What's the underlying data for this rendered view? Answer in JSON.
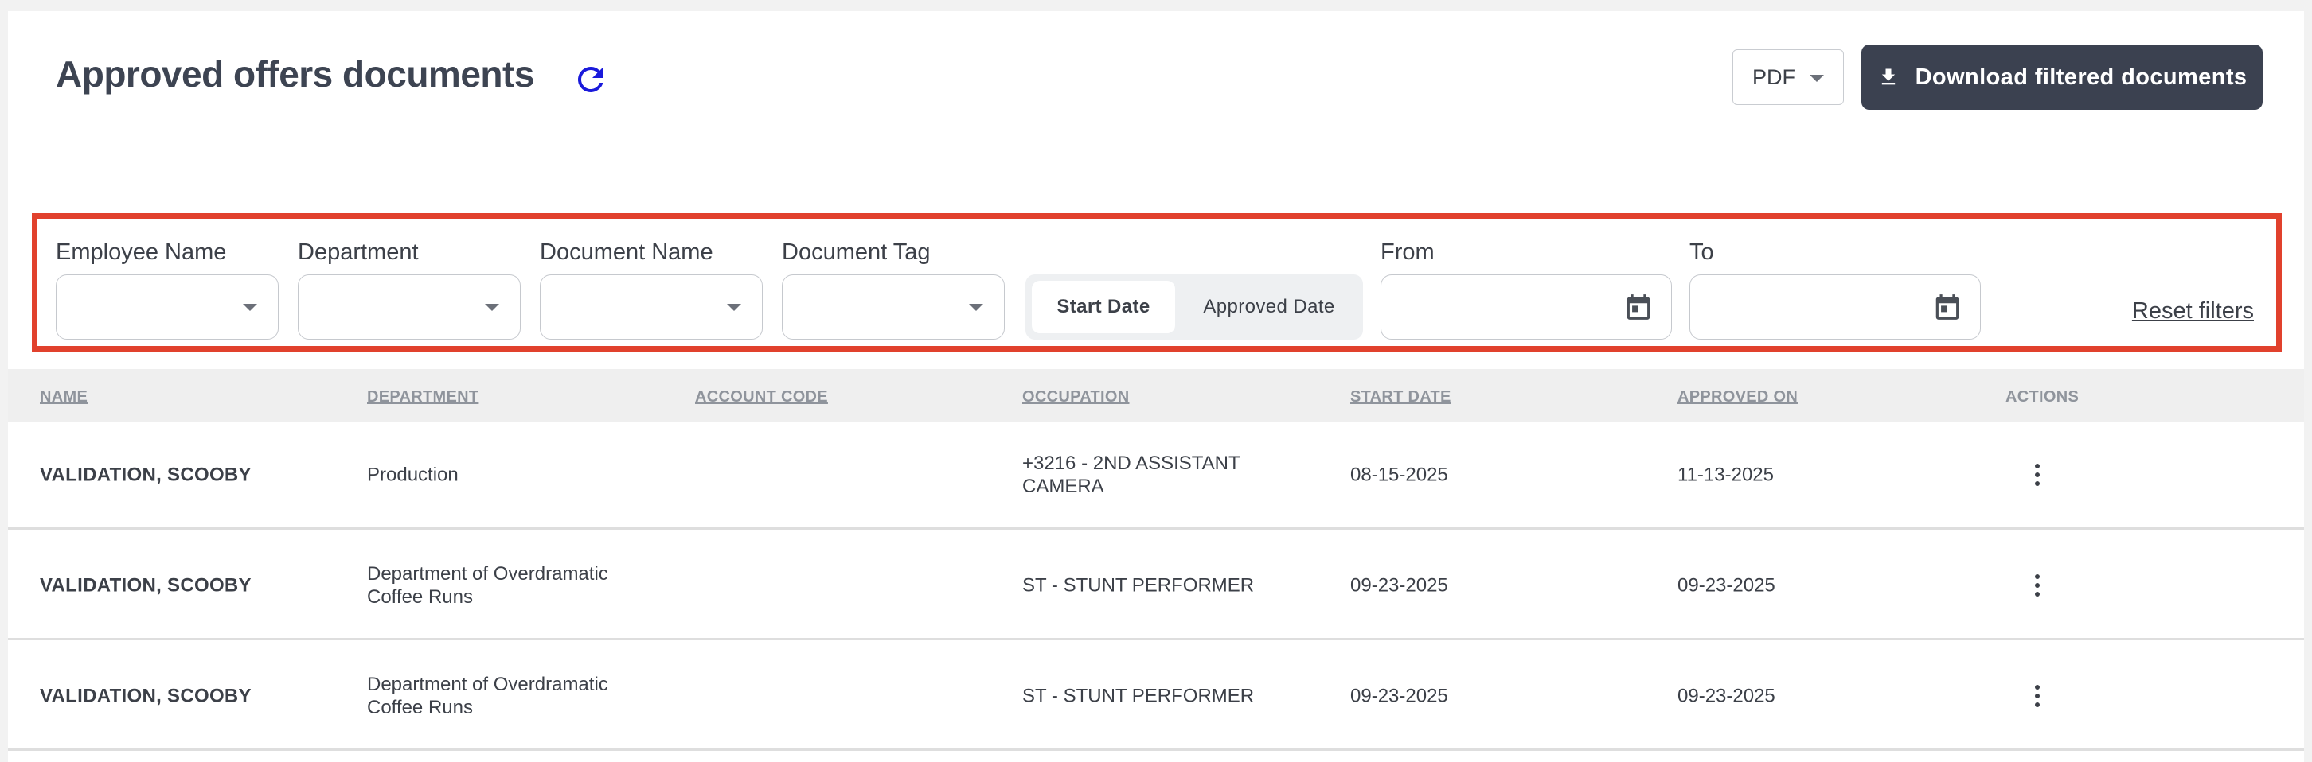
{
  "header": {
    "title": "Approved offers documents",
    "format_value": "PDF",
    "download_label": "Download filtered documents"
  },
  "filters": {
    "employee_name_label": "Employee Name",
    "department_label": "Department",
    "document_name_label": "Document Name",
    "document_tag_label": "Document Tag",
    "toggle_start_date": "Start Date",
    "toggle_approved_date": "Approved Date",
    "from_label": "From",
    "to_label": "To",
    "reset_label": "Reset filters",
    "highlight_color": "#e1412d"
  },
  "table": {
    "columns": [
      "NAME",
      "DEPARTMENT",
      "ACCOUNT CODE",
      "OCCUPATION",
      "START DATE",
      "APPROVED ON",
      "ACTIONS"
    ],
    "rows": [
      {
        "name": "VALIDATION, SCOOBY",
        "department": "Production",
        "account_code": "",
        "occupation": "+3216 - 2ND ASSISTANT CAMERA",
        "start_date": "08-15-2025",
        "approved_on": "11-13-2025"
      },
      {
        "name": "VALIDATION, SCOOBY",
        "department": "Department of Overdramatic Coffee Runs",
        "account_code": "",
        "occupation": "ST - STUNT PERFORMER",
        "start_date": "09-23-2025",
        "approved_on": "09-23-2025"
      },
      {
        "name": "VALIDATION, SCOOBY",
        "department": "Department of Overdramatic Coffee Runs",
        "account_code": "",
        "occupation": "ST - STUNT PERFORMER",
        "start_date": "09-23-2025",
        "approved_on": "09-23-2025"
      }
    ]
  },
  "icons": {
    "refresh": "refresh-icon",
    "download": "download-icon",
    "calendar": "calendar-icon",
    "more": "more-vertical-icon",
    "refresh_color": "#1a1adb"
  }
}
